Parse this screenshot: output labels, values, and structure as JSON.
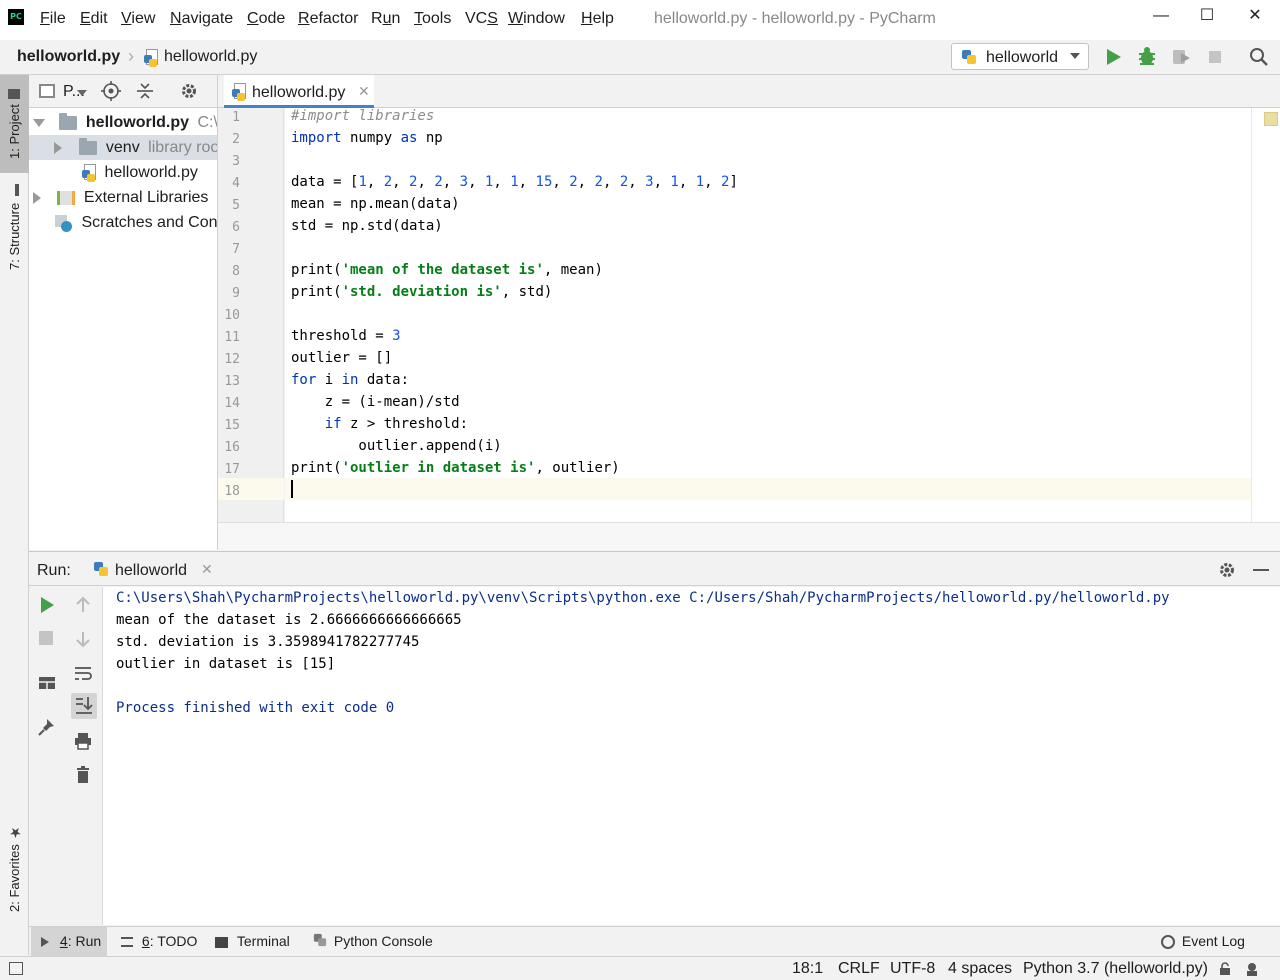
{
  "window": {
    "title": "helloworld.py - helloworld.py - PyCharm",
    "controls": {
      "minimize": "—",
      "maximize": "☐",
      "close": "✕"
    }
  },
  "menu": [
    {
      "prefix": "",
      "ul": "F",
      "rest": "ile"
    },
    {
      "prefix": "",
      "ul": "E",
      "rest": "dit"
    },
    {
      "prefix": "",
      "ul": "V",
      "rest": "iew"
    },
    {
      "prefix": "",
      "ul": "N",
      "rest": "avigate"
    },
    {
      "prefix": "",
      "ul": "C",
      "rest": "ode"
    },
    {
      "prefix": "",
      "ul": "R",
      "rest": "efactor"
    },
    {
      "prefix": "R",
      "ul": "u",
      "rest": "n"
    },
    {
      "prefix": "",
      "ul": "T",
      "rest": "ools"
    },
    {
      "prefix": "VC",
      "ul": "S",
      "rest": ""
    },
    {
      "prefix": "",
      "ul": "W",
      "rest": "indow"
    },
    {
      "prefix": "",
      "ul": "H",
      "rest": "elp"
    }
  ],
  "navbar": {
    "project": "helloworld.py",
    "file": "helloworld.py",
    "run_config": "helloworld"
  },
  "left_stripe": {
    "project_tab": "1: Project",
    "structure_tab": "7: Structure",
    "favorites_tab": "2: Favorites"
  },
  "project_panel": {
    "view_label": "P...",
    "tree": {
      "root_name": "helloworld.py",
      "root_path": "C:\\U",
      "venv_name": "venv",
      "venv_hint": "library root",
      "file_name": "helloworld.py",
      "external": "External Libraries",
      "scratches": "Scratches and Consoles"
    }
  },
  "editor": {
    "tab_label": "helloworld.py",
    "line_numbers": [
      "1",
      "2",
      "3",
      "4",
      "5",
      "6",
      "7",
      "8",
      "9",
      "10",
      "11",
      "12",
      "13",
      "14",
      "15",
      "16",
      "17",
      "18"
    ],
    "caret": "18:1"
  },
  "run": {
    "label": "Run:",
    "tab": "helloworld",
    "output": {
      "command": "C:\\Users\\Shah\\PycharmProjects\\helloworld.py\\venv\\Scripts\\python.exe C:/Users/Shah/PycharmProjects/helloworld.py/helloworld.py",
      "line1": "mean of the dataset is 2.6666666666666665",
      "line2": "std. deviation is 3.3598941782277745",
      "line3": "outlier in dataset is [15]",
      "exit": "Process finished with exit code 0"
    }
  },
  "tool_tabs": {
    "run": {
      "ul": "4",
      "rest": ": Run"
    },
    "todo": {
      "ul": "6",
      "rest": ": TODO"
    },
    "terminal": "Terminal",
    "console": "Python Console",
    "event_log": "Event Log"
  },
  "status": {
    "position": "18:1",
    "line_sep": "CRLF",
    "encoding": "UTF-8",
    "indent": "4 spaces",
    "interpreter": "Python 3.7 (helloworld.py)"
  }
}
